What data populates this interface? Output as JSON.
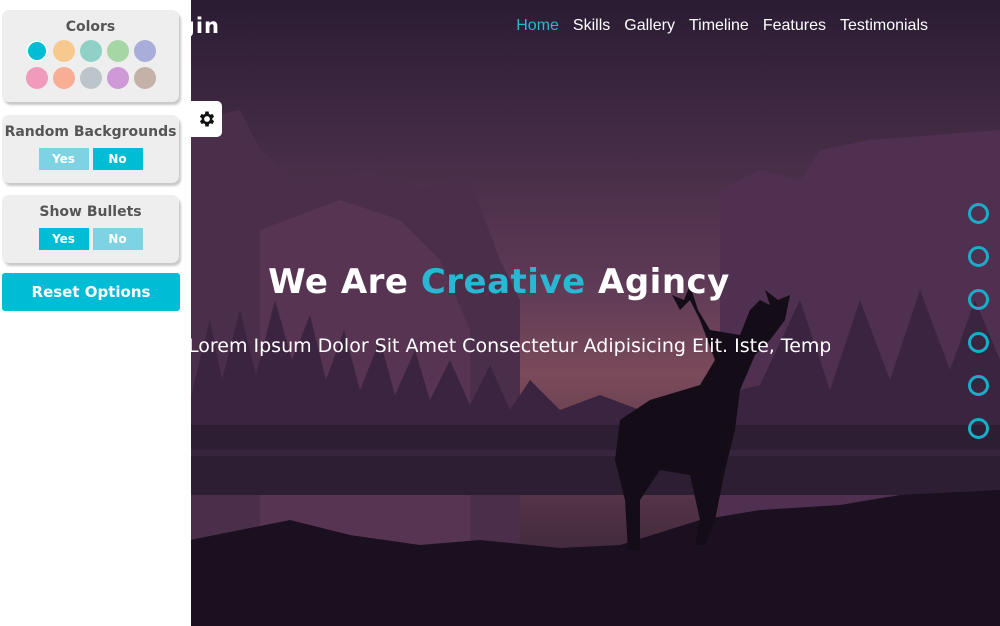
{
  "brand": {
    "name": "Login"
  },
  "nav": {
    "items": [
      {
        "label": "Home",
        "active": true
      },
      {
        "label": "Skills"
      },
      {
        "label": "Gallery"
      },
      {
        "label": "Timeline"
      },
      {
        "label": "Features"
      },
      {
        "label": "Testimonials"
      }
    ]
  },
  "hero": {
    "headline_before": "We Are ",
    "headline_accent": "Creative",
    "headline_after": " Agincy",
    "subline": "Lorem Ipsum Dolor Sit Amet Consectetur Adipisicing Elit. Iste, Tempora"
  },
  "bullets": {
    "count": 6,
    "color": "#18aec9"
  },
  "settings": {
    "colors_title": "Colors",
    "colors": [
      "#00bcd4",
      "#f8c98f",
      "#8fd1c6",
      "#a7d6a5",
      "#a9add9",
      "#f09bbb",
      "#f7ae95",
      "#bcc6ca",
      "#cf99d7",
      "#c4b1a7"
    ],
    "backgrounds_title": "Random Backgrounds",
    "backgrounds_yes": "Yes",
    "backgrounds_no": "No",
    "bullets_title": "Show Bullets",
    "bullets_yes": "Yes",
    "bullets_no": "No",
    "reset_label": "Reset Options"
  },
  "theme": {
    "accent": "#00bcd4"
  }
}
